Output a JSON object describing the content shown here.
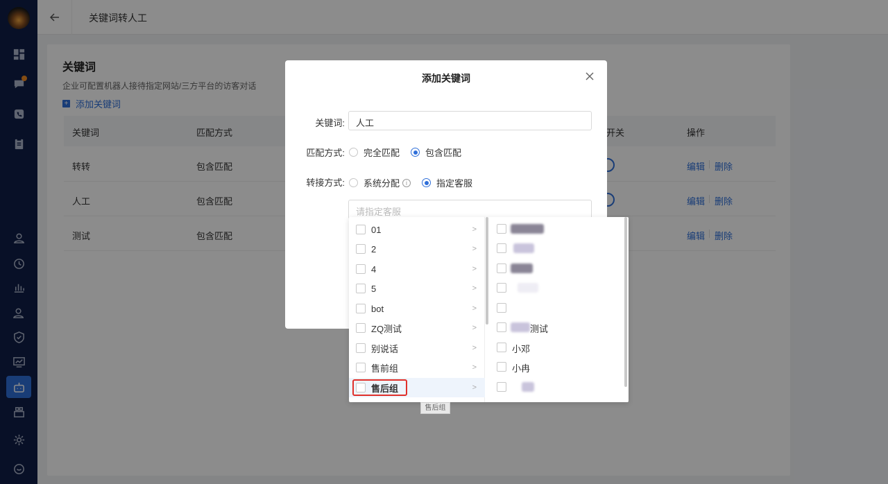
{
  "topbar": {
    "title": "关键词转人工"
  },
  "card": {
    "title": "关键词",
    "desc": "企业可配置机器人接待指定网站/三方平台的访客对话",
    "add_label": "添加关键词"
  },
  "table": {
    "headers": [
      "关键词",
      "匹配方式",
      "开关",
      "操作"
    ],
    "rows": [
      {
        "keyword": "转转",
        "match": "包含匹配",
        "edit": "编辑",
        "delete": "删除"
      },
      {
        "keyword": "人工",
        "match": "包含匹配",
        "edit": "编辑",
        "delete": "删除"
      },
      {
        "keyword": "测试",
        "match": "包含匹配",
        "edit": "编辑",
        "delete": "删除"
      }
    ]
  },
  "modal": {
    "title": "添加关键词",
    "keyword_label": "关键词:",
    "keyword_value": "人工",
    "match_label": "匹配方式:",
    "match_options": [
      "完全匹配",
      "包含匹配"
    ],
    "match_selected": "包含匹配",
    "transfer_label": "转接方式:",
    "transfer_options": [
      "系统分配",
      "指定客服"
    ],
    "transfer_selected": "指定客服",
    "agent_placeholder": "请指定客服"
  },
  "cascader": {
    "groups": [
      "01",
      "2",
      "4",
      "5",
      "bot",
      "ZQ测试",
      "别说话",
      "售前组",
      "售后组"
    ],
    "hovered_group": "售后组",
    "members": [
      "",
      "",
      "",
      "",
      "",
      "测试",
      "小邓",
      "小冉",
      ""
    ]
  },
  "tooltip": "售后组",
  "colors": {
    "primary": "#2f6fd9",
    "sidebar": "#0f1e47",
    "highlight_ring": "#e0302a"
  }
}
